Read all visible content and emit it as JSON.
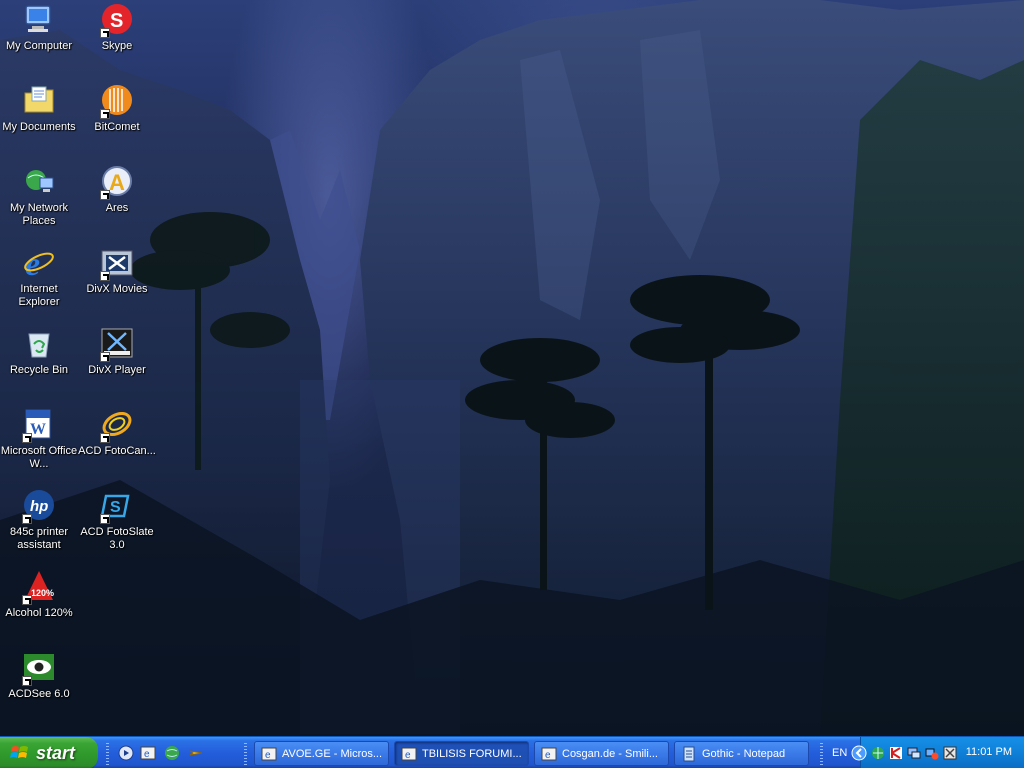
{
  "desktop_icons": [
    {
      "label": "My Computer",
      "icon": "my-computer-icon",
      "shortcut": false
    },
    {
      "label": "Skype",
      "icon": "skype-icon",
      "shortcut": true
    },
    {
      "label": "My Documents",
      "icon": "my-documents-icon",
      "shortcut": false
    },
    {
      "label": "BitComet",
      "icon": "bitcomet-icon",
      "shortcut": true
    },
    {
      "label": "My Network Places",
      "icon": "network-places-icon",
      "shortcut": false
    },
    {
      "label": "Ares",
      "icon": "ares-icon",
      "shortcut": true
    },
    {
      "label": "Internet Explorer",
      "icon": "internet-explorer-icon",
      "shortcut": false
    },
    {
      "label": "DivX Movies",
      "icon": "divx-movies-icon",
      "shortcut": true
    },
    {
      "label": "Recycle Bin",
      "icon": "recycle-bin-icon",
      "shortcut": false
    },
    {
      "label": "DivX Player",
      "icon": "divx-player-icon",
      "shortcut": true
    },
    {
      "label": "Microsoft Office W...",
      "icon": "word-icon",
      "shortcut": true
    },
    {
      "label": "ACD FotoCan...",
      "icon": "acd-fotocanvas-icon",
      "shortcut": true
    },
    {
      "label": "845c printer assistant",
      "icon": "hp-printer-icon",
      "shortcut": true
    },
    {
      "label": "ACD FotoSlate 3.0",
      "icon": "acd-fotoslate-icon",
      "shortcut": true
    },
    {
      "label": "Alcohol 120%",
      "icon": "alcohol-icon",
      "shortcut": true
    },
    {
      "label": "ACDSee 6.0",
      "icon": "acdsee-icon",
      "shortcut": true
    }
  ],
  "taskbar": {
    "start_label": "start",
    "quick_launch": [
      "media-player-icon",
      "ie-quick-icon",
      "network-globe-icon",
      "rocket-icon"
    ],
    "tasks": [
      {
        "label": "AVOE.GE - Micros...",
        "icon": "ie-task-icon",
        "active": false
      },
      {
        "label": "TBILISIS FORUMI...",
        "icon": "ie-task-icon",
        "active": true
      },
      {
        "label": "Cosgan.de - Smili...",
        "icon": "ie-task-icon",
        "active": false
      },
      {
        "label": "Gothic - Notepad",
        "icon": "notepad-icon",
        "active": false
      }
    ],
    "language": "EN",
    "clock": "11:01 PM",
    "tray_icons": [
      "show-hidden-icon",
      "network-tray-icon",
      "antivirus-icon",
      "display-tray-icon",
      "connection-tray-icon",
      "tools-tray-icon"
    ]
  }
}
